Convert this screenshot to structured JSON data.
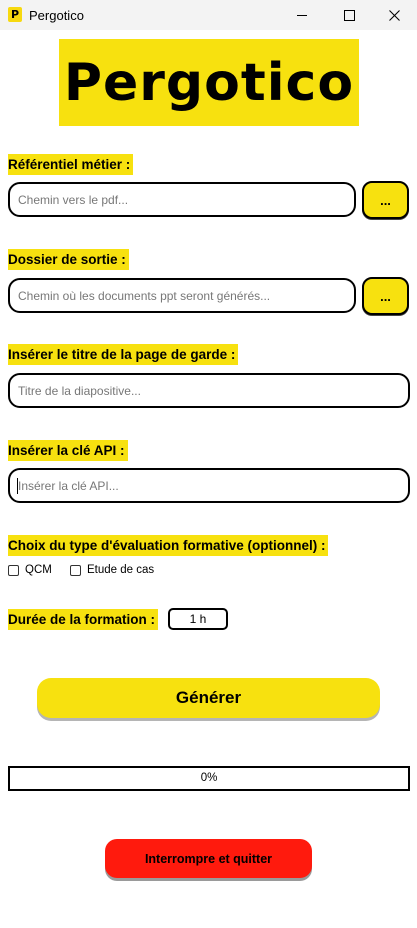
{
  "window": {
    "title": "Pergotico",
    "icon_letter": "P",
    "icon": "app-logo-icon"
  },
  "logo": {
    "text": "Pergotico"
  },
  "referentiel": {
    "label": "Référentiel métier :",
    "placeholder": "Chemin vers le pdf...",
    "browse_label": "..."
  },
  "output": {
    "label": "Dossier de sortie :",
    "placeholder": "Chemin où les documents ppt seront générés...",
    "browse_label": "..."
  },
  "title_page": {
    "label": "Insérer le titre de la page de garde :",
    "placeholder": "Titre de la diapositive..."
  },
  "api_key": {
    "label": "Insérer la clé API :",
    "placeholder": "Insérer la clé API..."
  },
  "evaluation": {
    "label": "Choix du type d'évaluation formative (optionnel) :",
    "options": [
      {
        "label": "QCM",
        "checked": false
      },
      {
        "label": "Etude de cas",
        "checked": false
      }
    ]
  },
  "duration": {
    "label": "Durée de la formation :",
    "value": "1 h"
  },
  "generate_label": "Générer",
  "progress": {
    "value": 0,
    "text": "0%"
  },
  "quit_label": "Interrompre et quitter",
  "colors": {
    "accent": "#f7e10f",
    "danger": "#ff1a0d",
    "border": "#000000"
  }
}
